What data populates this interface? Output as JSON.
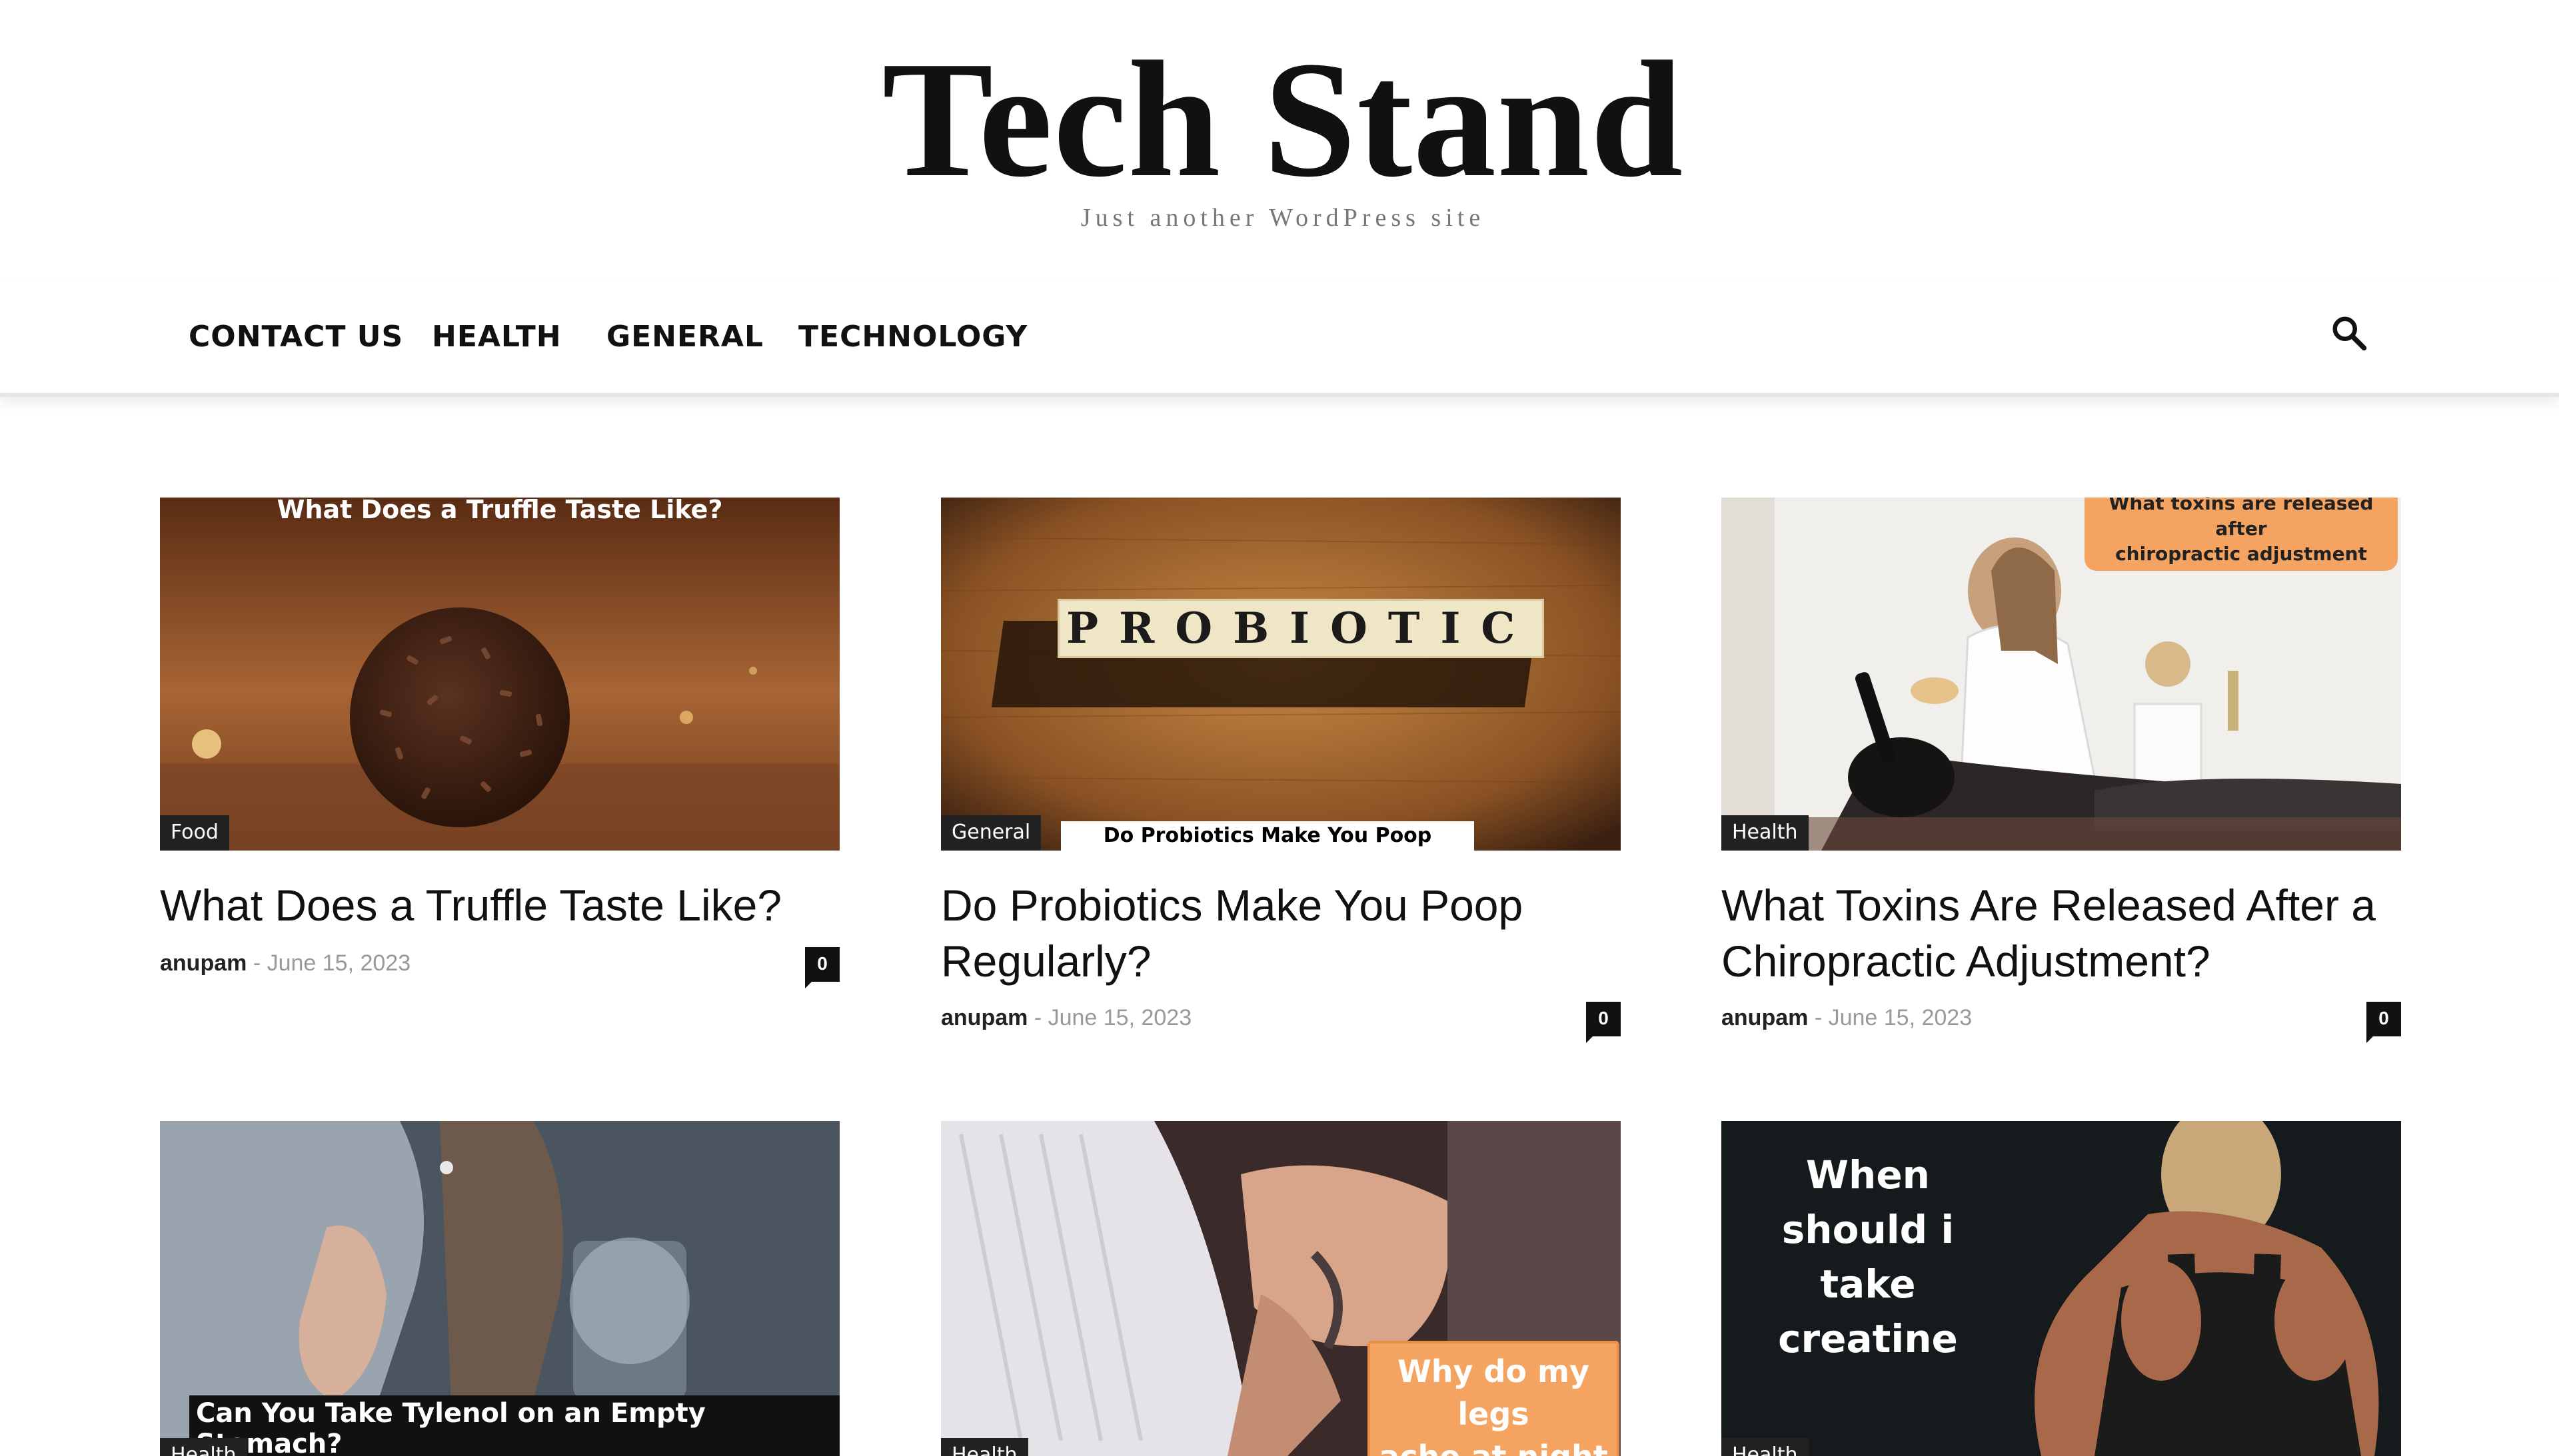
{
  "site": {
    "title": "Tech Stand",
    "tagline": "Just another WordPress site"
  },
  "nav": {
    "items": [
      "CONTACT US",
      "HEALTH",
      "GENERAL",
      "TECHNOLOGY"
    ],
    "search_icon": "search-icon"
  },
  "posts": [
    {
      "title": "What Does a Truffle Taste Like?",
      "category": "Food",
      "author": "anupam",
      "date": "June 15, 2023",
      "comments": "0",
      "image_caption": "What Does a Truffle Taste Like?"
    },
    {
      "title": "Do Probiotics Make You Poop Regularly?",
      "category": "General",
      "author": "anupam",
      "date": "June 15, 2023",
      "comments": "0",
      "image_caption": "Do Probiotics Make You Poop Regularly?",
      "image_tiles": "PROBIOTIC"
    },
    {
      "title": "What Toxins Are Released After a Chiropractic Adjustment?",
      "category": "Health",
      "author": "anupam",
      "date": "June 15, 2023",
      "comments": "0",
      "image_caption_line1": "What toxins are released after",
      "image_caption_line2": "chiropractic adjustment"
    },
    {
      "category": "Health",
      "image_caption": "Can You Take Tylenol on an Empty Stomach?"
    },
    {
      "category": "Health",
      "image_caption_line1": "Why do my legs",
      "image_caption_line2": "ache at night"
    },
    {
      "category": "Health",
      "image_caption_line1": "When should i",
      "image_caption_line2": "take creatine"
    }
  ],
  "colors": {
    "text": "#111111",
    "meta": "#999999",
    "category_bg": "#222222",
    "accent_orange": "#f4a460"
  }
}
